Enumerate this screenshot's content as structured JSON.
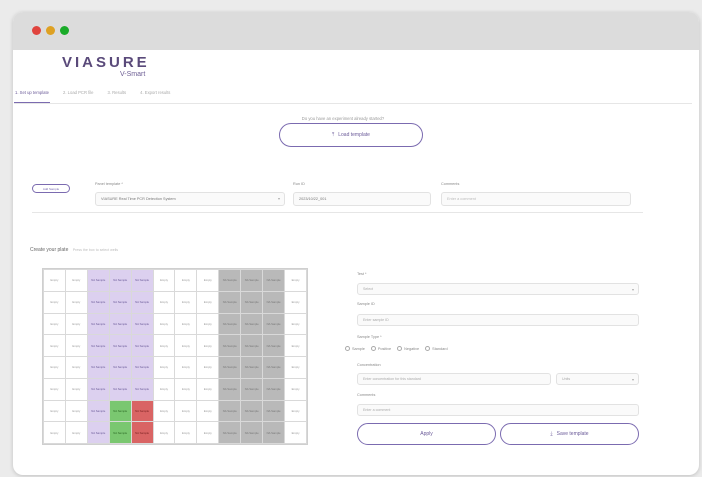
{
  "brand": {
    "name": "VIASURE",
    "sub": "V-Smart"
  },
  "tabs": [
    {
      "label": "1. Set up template",
      "active": true
    },
    {
      "label": "2. Load PCR file",
      "active": false
    },
    {
      "label": "3. Results",
      "active": false
    },
    {
      "label": "4. Export results",
      "active": false
    }
  ],
  "question": "Do you have an experiment already started?",
  "load_template": "Load template",
  "small_button": "Add Sample",
  "fields": {
    "panel_label": "Panel template *",
    "panel_value": "VIASURE Real Time PCR Detection System",
    "run_label": "Run ID",
    "run_value": "2023/10/22_001",
    "comments_label": "Comments",
    "comments_placeholder": "Enter a comment"
  },
  "create": {
    "title": "Create your plate",
    "hint": "Press the box to select wells"
  },
  "plate_rows": [
    [
      "Empty",
      "Empty",
      "p",
      "p",
      "p",
      "Empty",
      "Empty",
      "Empty",
      "g",
      "g",
      "g",
      "Empty"
    ],
    [
      "Empty",
      "Empty",
      "p",
      "p",
      "p",
      "Empty",
      "Empty",
      "Empty",
      "g",
      "g",
      "g",
      "Empty"
    ],
    [
      "Empty",
      "Empty",
      "p",
      "p",
      "p",
      "Empty",
      "Empty",
      "Empty",
      "g",
      "g",
      "g",
      "Empty"
    ],
    [
      "Empty",
      "Empty",
      "p",
      "p",
      "p",
      "Empty",
      "Empty",
      "Empty",
      "g",
      "g",
      "g",
      "Empty"
    ],
    [
      "Empty",
      "Empty",
      "p",
      "p",
      "p",
      "Empty",
      "Empty",
      "Empty",
      "g",
      "g",
      "g",
      "Empty"
    ],
    [
      "Empty",
      "Empty",
      "p",
      "p",
      "p",
      "Empty",
      "Empty",
      "Empty",
      "g",
      "g",
      "g",
      "Empty"
    ],
    [
      "Empty",
      "Empty",
      "p",
      "G",
      "R",
      "Empty",
      "Empty",
      "Empty",
      "g",
      "g",
      "g",
      "Empty"
    ],
    [
      "Empty",
      "Empty",
      "p",
      "G",
      "R",
      "Empty",
      "Empty",
      "Empty",
      "g",
      "g",
      "g",
      "Empty"
    ]
  ],
  "well_text": "NA Sample",
  "right": {
    "test_label": "Test *",
    "test_placeholder": "Select",
    "sample_id_label": "Sample ID",
    "sample_id_placeholder": "Enter sample ID",
    "sample_type_label": "Sample Type *",
    "sample_types": [
      "Sample",
      "Positive",
      "Negative",
      "Standard"
    ],
    "concentration_label": "Concentration",
    "concentration_placeholder": "Enter concentration for this standard",
    "unit_placeholder": "Units",
    "comments_label": "Comments",
    "comments_placeholder": "Enter a comment"
  },
  "apply": "Apply",
  "save_template": "Save template"
}
